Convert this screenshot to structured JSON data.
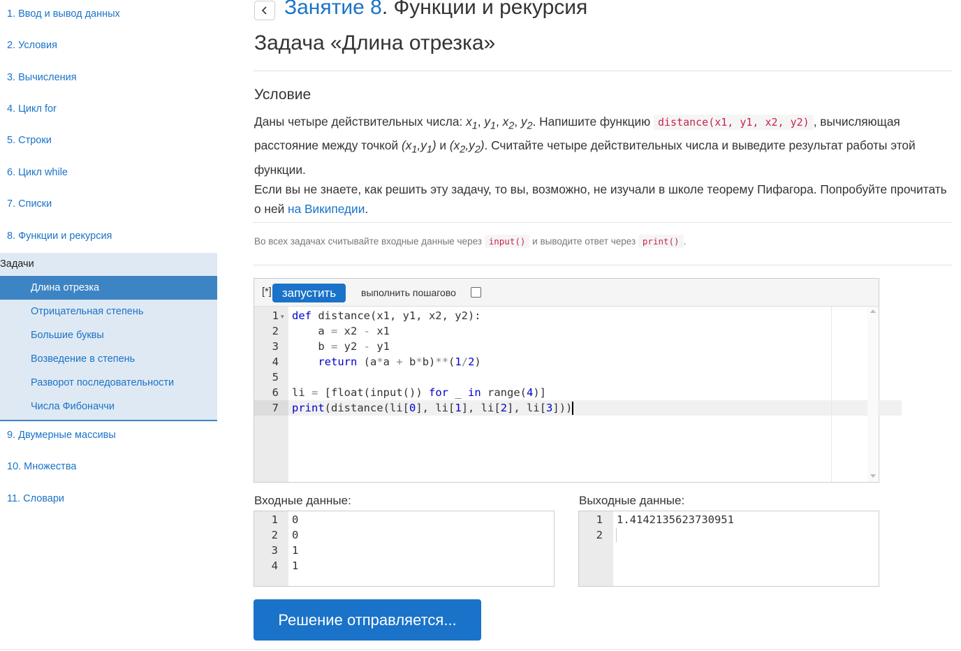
{
  "sidebar": {
    "lessons_top": [
      "1. Ввод и вывод данных",
      "2. Условия",
      "3. Вычисления",
      "4. Цикл for",
      "5. Строки",
      "6. Цикл while",
      "7. Списки",
      "8. Функции и рекурсия"
    ],
    "tasks_header": "Задачи",
    "tasks": [
      "Длина отрезка",
      "Отрицательная степень",
      "Большие буквы",
      "Возведение в степень",
      "Разворот последовательности",
      "Числа Фибоначчи"
    ],
    "active_task_index": 0,
    "lessons_bottom": [
      "9. Двумерные массивы",
      "10. Множества",
      "11. Словари"
    ]
  },
  "header": {
    "back_icon": "chevron-left-icon",
    "lesson_link": "Занятие 8",
    "lesson_rest": ". Функции и рекурсия",
    "task_title": "Задача «Длина отрезка»"
  },
  "statement": {
    "heading": "Условие",
    "p1_start": "Даны четыре действительных числа: ",
    "x1": "x",
    "sub1": "1",
    "y1": "y",
    "sub1b": "1",
    "x2": "x",
    "sub2": "2",
    "y2": "y",
    "sub2b": "2",
    "p1_mid": ". Напишите функцию ",
    "func_code": "distance(x1, y1, x2, y2)",
    "p1_end": ", вычисляющая расстояние между точкой ",
    "point1": "(x1,y1)",
    "p1_and": " и ",
    "point2": "(x2,y2)",
    "p1_tail": ". Считайте четыре действительных числа и выведите результат работы этой функции.",
    "p2_start": "Если вы не знаете, как решить эту задачу, то вы, возможно, не изучали в школе теорему Пифагора. Попробуйте прочитать о ней ",
    "p2_link": "на Википедии",
    "p2_end": "."
  },
  "hint": {
    "start": "Во всех задачах считывайте входные данные через ",
    "input_code": "input()",
    "mid": " и выводите ответ через ",
    "print_code": "print()",
    "end": "."
  },
  "editor": {
    "star": "[*]",
    "run_label": "запустить",
    "step_label": "выполнить пошагово",
    "step_checked": false,
    "line_numbers": [
      "1",
      "2",
      "3",
      "4",
      "5",
      "6",
      "7"
    ],
    "code_lines": [
      "def distance(x1, y1, x2, y2):",
      "    a = x2 - x1",
      "    b = y2 - y1",
      "    return (a*a + b*b)**(1/2)",
      "",
      "li = [float(input()) for _ in range(4)]",
      "print(distance(li[0], li[1], li[2], li[3]))"
    ]
  },
  "input": {
    "label": "Входные данные:",
    "line_numbers": [
      "1",
      "2",
      "3",
      "4"
    ],
    "lines": [
      "0",
      "0",
      "1",
      "1"
    ]
  },
  "output": {
    "label": "Выходные данные:",
    "line_numbers": [
      "1",
      "2"
    ],
    "lines": [
      "1.4142135623730951",
      ""
    ]
  },
  "submit": {
    "label": "Решение отправляется..."
  },
  "colors": {
    "accent": "#1a73c8",
    "active_task_bg": "#3d84c4",
    "tasks_bg": "#dfe9f3",
    "code_red": "#c7254e",
    "keyword": "#0000cc"
  }
}
